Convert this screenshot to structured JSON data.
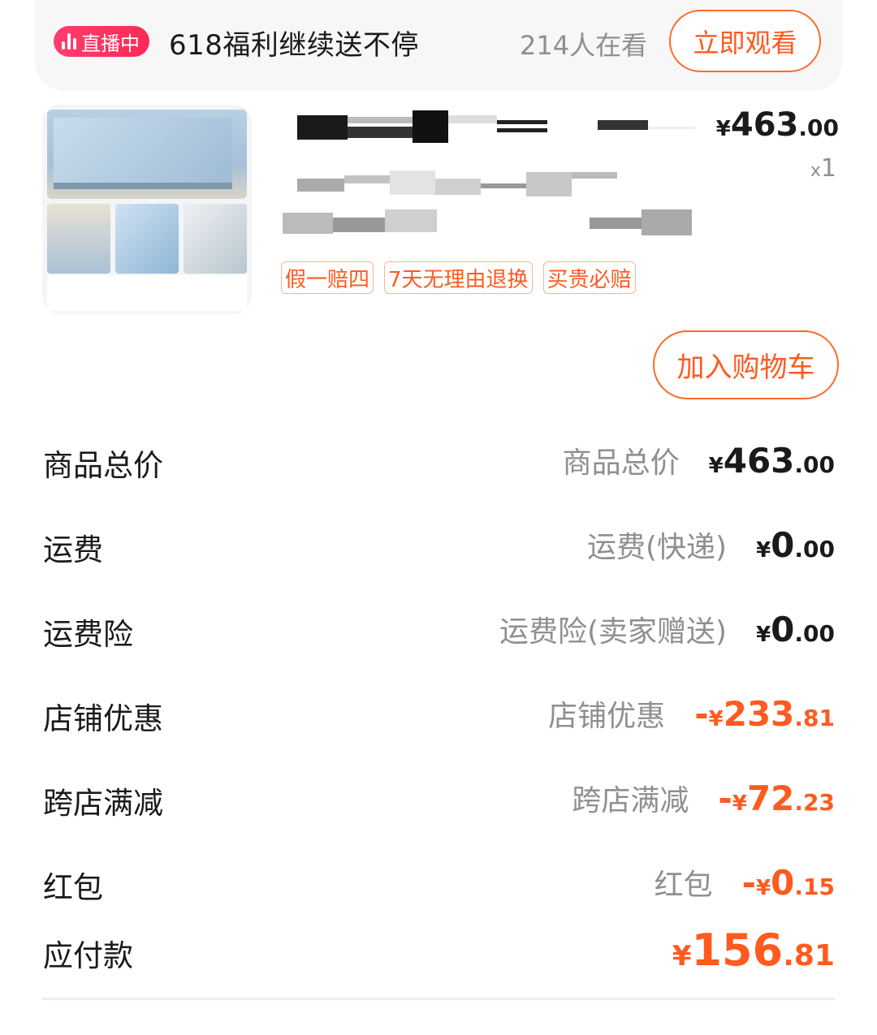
{
  "live_banner": {
    "badge_label": "直播中",
    "title": "618福利继续送不停",
    "viewers": "214人在看",
    "watch_button": "立即观看"
  },
  "product": {
    "price": {
      "currency": "¥",
      "integer": "463",
      "decimal": ".00"
    },
    "quantity_prefix": "x",
    "quantity": "1",
    "tags": [
      "假一赔四",
      "7天无理由退换",
      "买贵必赔"
    ],
    "add_to_cart": "加入购物车"
  },
  "summary": [
    {
      "label": "商品总价",
      "sub": "商品总价",
      "sign": "",
      "currency": "¥",
      "integer": "463",
      "decimal": ".00",
      "negative": false
    },
    {
      "label": "运费",
      "sub": "运费(快递)",
      "sign": "",
      "currency": "¥",
      "integer": "0",
      "decimal": ".00",
      "negative": false
    },
    {
      "label": "运费险",
      "sub": "运费险(卖家赠送)",
      "sign": "",
      "currency": "¥",
      "integer": "0",
      "decimal": ".00",
      "negative": false
    },
    {
      "label": "店铺优惠",
      "sub": "店铺优惠",
      "sign": "-",
      "currency": "¥",
      "integer": "233",
      "decimal": ".81",
      "negative": true
    },
    {
      "label": "跨店满减",
      "sub": "跨店满减",
      "sign": "-",
      "currency": "¥",
      "integer": "72",
      "decimal": ".23",
      "negative": true
    },
    {
      "label": "红包",
      "sub": "红包",
      "sign": "-",
      "currency": "¥",
      "integer": "0",
      "decimal": ".15",
      "negative": true
    }
  ],
  "total": {
    "label": "应付款",
    "currency": "¥",
    "integer": "156",
    "decimal": ".81"
  },
  "colors": {
    "accent": "#ff5a1f",
    "live_badge": "#ff2a55",
    "muted_text": "#8f8f8f"
  }
}
